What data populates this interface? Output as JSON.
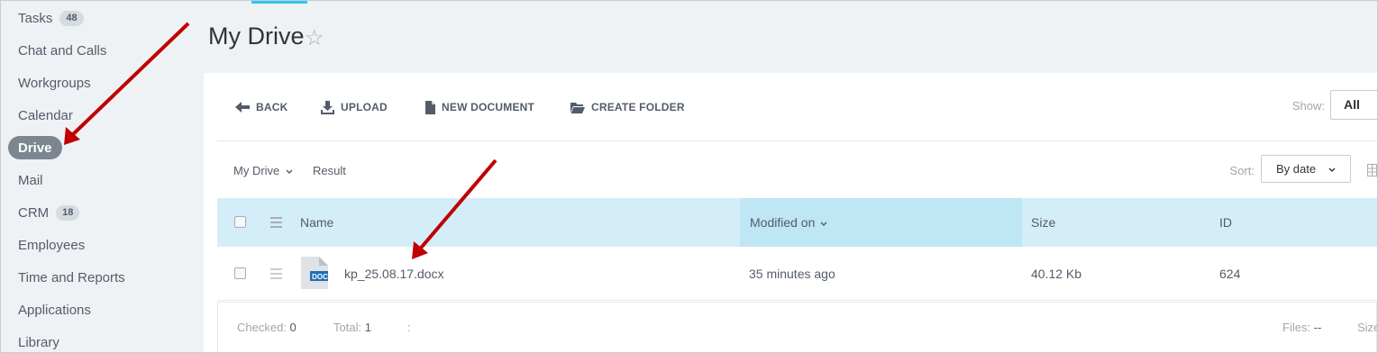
{
  "sidebar": {
    "items": [
      {
        "label": "Tasks",
        "count": "48"
      },
      {
        "label": "Chat and Calls"
      },
      {
        "label": "Workgroups"
      },
      {
        "label": "Calendar"
      },
      {
        "label": "Drive",
        "active": true
      },
      {
        "label": "Mail"
      },
      {
        "label": "CRM",
        "count": "18"
      },
      {
        "label": "Employees"
      },
      {
        "label": "Time and Reports"
      },
      {
        "label": "Applications"
      },
      {
        "label": "Library"
      }
    ]
  },
  "header": {
    "title": "My Drive",
    "star_icon": "star-outline-icon"
  },
  "toolbar": {
    "back_label": "BACK",
    "upload_label": "UPLOAD",
    "new_document_label": "NEW DOCUMENT",
    "create_folder_label": "CREATE FOLDER",
    "show_label": "Show:",
    "show_value": "All"
  },
  "filter": {
    "breadcrumb_root": "My Drive",
    "breadcrumb_result": "Result",
    "sort_label": "Sort:",
    "sort_value": "By date"
  },
  "table": {
    "columns": {
      "name": "Name",
      "modified": "Modified on",
      "size": "Size",
      "id": "ID"
    },
    "rows": [
      {
        "name": "kp_25.08.17.docx",
        "modified": "35 minutes ago",
        "size": "40.12 Kb",
        "id": "624",
        "icon_label": "DOC"
      }
    ]
  },
  "footer": {
    "checked_label": "Checked:",
    "checked_value": "0",
    "total_label": "Total:",
    "total_value": "1",
    "separator": ":",
    "files_label": "Files:",
    "files_value": "--",
    "size_label": "Size"
  },
  "colors": {
    "accent": "#2fc6f6",
    "active_nav": "#7b8691",
    "table_header": "#d3eef9",
    "annotation_arrow": "#c00000"
  }
}
